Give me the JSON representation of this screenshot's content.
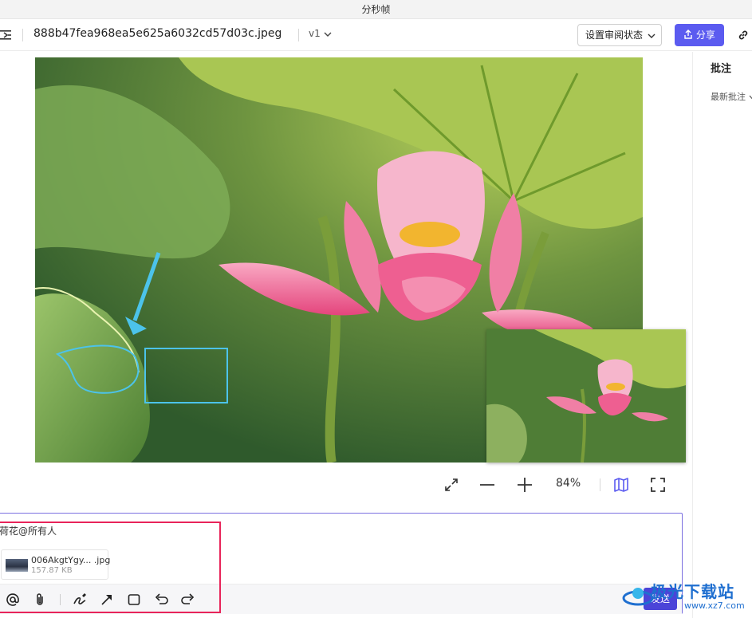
{
  "window": {
    "title": "分秒帧"
  },
  "toolbar": {
    "filename": "888b47fea968ea5e625a6032cd57d03c.jpeg",
    "version": "v1",
    "review_button": "设置审阅状态",
    "share_button": "分享"
  },
  "viewer": {
    "zoom": "84%"
  },
  "sidebar": {
    "title": "批注",
    "sort": "最新批注"
  },
  "comment": {
    "text": "荷花@所有人",
    "attachment": {
      "name": "006AkgtYgy... .jpg",
      "size": "157.87 KB"
    },
    "send_button": "发送"
  },
  "watermark": {
    "text": "极光下载站",
    "url": "www.xz7.com"
  },
  "colors": {
    "accent": "#5b5bf0",
    "highlight": "#e8245a",
    "annotation": "#4cc3ea"
  }
}
